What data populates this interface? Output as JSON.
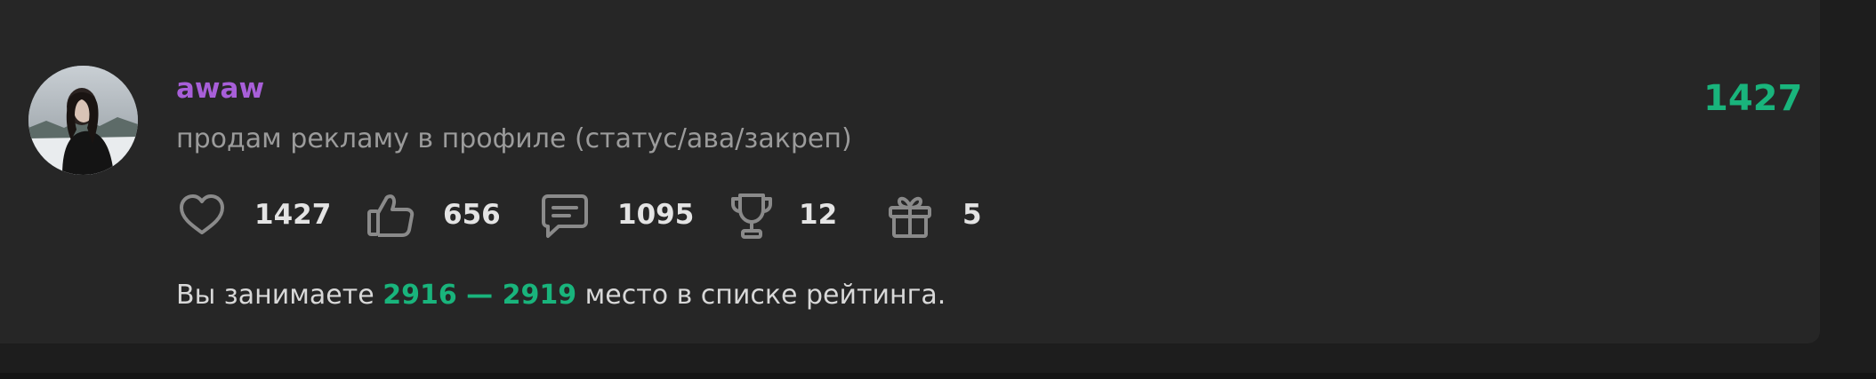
{
  "user": {
    "username": "awaw",
    "status": "продам рекламу в профиле (статус/ава/закреп)",
    "score": "1427",
    "avatar_icon": "avatar-photo"
  },
  "stats": [
    {
      "icon": "heart-icon",
      "value": "1427"
    },
    {
      "icon": "thumbs-up-icon",
      "value": "656"
    },
    {
      "icon": "comment-icon",
      "value": "1095"
    },
    {
      "icon": "trophy-icon",
      "value": "12"
    },
    {
      "icon": "gift-icon",
      "value": "5"
    }
  ],
  "rank": {
    "prefix": "Вы занимаете ",
    "range": "2916 — 2919",
    "suffix": " место в списке рейтинга."
  },
  "colors": {
    "username": "#a85fd9",
    "accent": "#19b47c",
    "card_bg": "#262626",
    "page_bg": "#1d1d1d"
  }
}
